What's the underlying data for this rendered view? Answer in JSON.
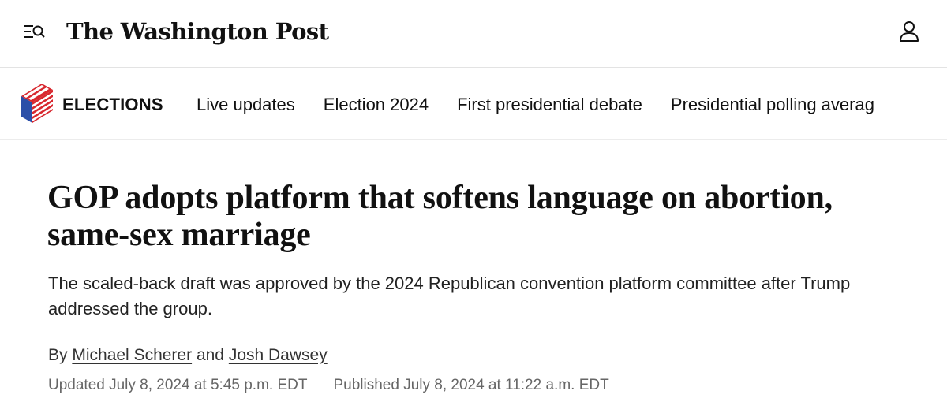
{
  "header": {
    "logo_text": "The Washington Post",
    "menu_icon": "menu-search-icon",
    "account_icon": "user-icon"
  },
  "subnav": {
    "section_label": "ELECTIONS",
    "flag_icon": "flag-icon",
    "items": [
      {
        "label": "Live updates"
      },
      {
        "label": "Election 2024"
      },
      {
        "label": "First presidential debate"
      },
      {
        "label": "Presidential polling averag"
      }
    ]
  },
  "article": {
    "headline": "GOP adopts platform that softens language on abortion, same-sex marriage",
    "dek": "The scaled-back draft was approved by the 2024 Republican convention platform committee after Trump addressed the group.",
    "byline": {
      "prefix": "By",
      "author1": "Michael Scherer",
      "conjunction": "and",
      "author2": "Josh Dawsey"
    },
    "updated": "Updated July 8, 2024 at 5:45 p.m. EDT",
    "published": "Published July 8, 2024 at 11:22 a.m. EDT"
  },
  "colors": {
    "flag_blue": "#2b4fa8",
    "flag_red": "#d8282f",
    "text": "#111111",
    "muted": "#666666"
  }
}
